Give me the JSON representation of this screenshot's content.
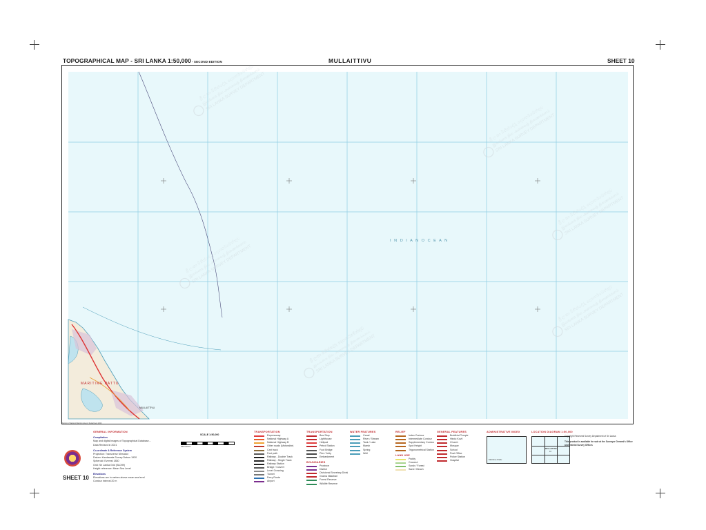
{
  "header": {
    "left_title": "TOPOGRAPHICAL MAP - SRI LANKA 1:50,000",
    "edition": "- SECOND EDITION",
    "center_title": "MULLAITTIVU",
    "sheet_label": "SHEET 10"
  },
  "map": {
    "sea_label": "I N D I A N   O C E A N",
    "coastal_labels": [
      "MARITIME PATTU",
      "MULLAITTIVU"
    ],
    "watermark_lines": [
      "ශ්‍රී ලංකා මිනින්දෝරු දෙපාර්තමේන්තුව",
      "இலங்கை நில அளவைத் திணைக்களம்",
      "SRI LANKA SURVEY DEPARTMENT"
    ],
    "colors": {
      "sea": "#e8f8fb",
      "grid": "#8fcde3",
      "coast": "#4a9cb8",
      "land": "#f3ecdc",
      "road": "#d33",
      "ocean_text": "#5a9ab0"
    },
    "footnote": "Reprint of National Mapping Agency Department 2022"
  },
  "legend": {
    "general_information": {
      "title": "GENERAL INFORMATION",
      "compilation_heading": "Compilation",
      "compilation_lines": [
        "Map and digital images of Topographical Database...",
        "Data Revised in 2021"
      ],
      "coordinate_heading": "Co-ordinate & Reference System",
      "coordinate_lines": [
        "Projection: Transverse Mercator",
        "Datum: Kandawala Survey Datum 1930",
        "Spheroid: Everest 1830",
        "Grid: Sri Lanka Grid (SLD99)",
        "Height reference: Mean Sea Level"
      ],
      "elevation_heading": "Elevations",
      "elevation_lines": [
        "Elevations are in metres above mean sea level",
        "Contour interval 20 m"
      ],
      "sheet_no": "SHEET 10"
    },
    "scale": {
      "title": "SCALE 1:50,000",
      "note": "Kilometres"
    },
    "transportation_1": {
      "title": "TRANSPORTATION",
      "items": [
        "Expressway",
        "National Highway A",
        "National Highway B",
        "Other roads (Motorable)",
        "Cart track",
        "Foot path",
        "Railway - Double Track",
        "Railway - Single Track",
        "Railway Station",
        "Bridge / Culvert",
        "Level Crossing",
        "Tunnel",
        "Ferry Route",
        "Airport"
      ],
      "colors": [
        "#e03a3a",
        "#e85a2a",
        "#f0a030",
        "#c0392b",
        "#8a6d3b",
        "#555",
        "#222",
        "#222",
        "#222",
        "#555",
        "#888",
        "#777",
        "#2a6fb0",
        "#7b2d8e"
      ]
    },
    "transportation_2": {
      "title": "TRANSPORTATION",
      "items": [
        "Bus Stop",
        "Lighthouse",
        "Helipad",
        "Petrol Station",
        "Foot Bridge",
        "Pier / Jetty",
        "Embankment"
      ],
      "colors": [
        "#c0282c",
        "#c0282c",
        "#e03a3a",
        "#c0282c",
        "#555",
        "#444",
        "#555"
      ]
    },
    "boundaries": {
      "title": "BOUNDARIES",
      "items": [
        "Province",
        "District",
        "Divisional Secretary Division",
        "Grama Niladhari",
        "Forest Reserve",
        "Wildlife Reserve"
      ],
      "colors": [
        "#7b2d8e",
        "#7b2d8e",
        "#c0282c",
        "#c0282c",
        "#2e8b57",
        "#2e8b57"
      ]
    },
    "water_features": {
      "title": "WATER FEATURES",
      "items": [
        "Canal",
        "River / Stream",
        "Tank / Lake",
        "Marsh",
        "Spring",
        "Well"
      ],
      "colors": [
        "#4a9cb8",
        "#4a9cb8",
        "#4a9cb8",
        "#4a9cb8",
        "#4a9cb8",
        "#4a9cb8"
      ]
    },
    "relief": {
      "title": "RELIEF",
      "items": [
        "Index Contour",
        "Intermediate Contour",
        "Supplementary Contour",
        "Spot Height",
        "Trigonometrical Station"
      ],
      "colors": [
        "#b5651d",
        "#b5651d",
        "#b5651d",
        "#b5651d",
        "#b5651d"
      ]
    },
    "land_use": {
      "title": "LAND USE",
      "items": [
        "Paddy",
        "Coconut",
        "Scrub / Forest",
        "Sand / Beach"
      ],
      "colors": [
        "#e8e36a",
        "#a7d38c",
        "#7fbf6a",
        "#f0e0b0"
      ]
    },
    "general_features": {
      "title": "GENERAL FEATURES",
      "items": [
        "Buddhist Temple",
        "Hindu Kovil",
        "Church",
        "Mosque",
        "School",
        "Post Office",
        "Police Station",
        "Hospital"
      ],
      "colors": [
        "#c0282c",
        "#c0282c",
        "#c0282c",
        "#c0282c",
        "#c0282c",
        "#c0282c",
        "#c0282c",
        "#c0282c"
      ]
    },
    "admin_index": {
      "title": "ADMINISTRATIVE INDEX",
      "label": "Maritime Pattu"
    },
    "location_diagram": {
      "title": "LOCATION DIAGRAM 1:50,000",
      "labels": [
        "MULLAITTIVU",
        "10"
      ]
    },
    "copyright": [
      "Copyright Reserved Survey Department of Sri Lanka",
      "This product is available for sale at the Surveyor General's Office and District Survey Offices"
    ]
  }
}
